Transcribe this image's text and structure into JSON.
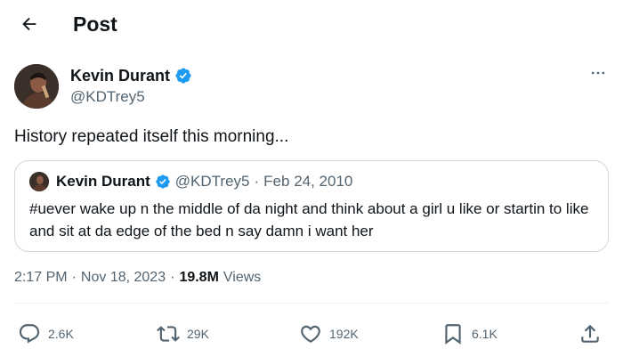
{
  "header": {
    "title": "Post",
    "back_icon": "arrow-left-icon"
  },
  "author": {
    "name": "Kevin Durant",
    "handle": "@KDTrey5",
    "verified_icon": "verified-badge-icon",
    "more_icon": "more-horizontal-icon"
  },
  "tweet": {
    "text": "History repeated itself this morning..."
  },
  "quote": {
    "name": "Kevin Durant",
    "handle": "@KDTrey5",
    "separator": "·",
    "date": "Feb 24, 2010",
    "text": "#uever wake up n the middle of da night and think about a girl u like or startin to like and sit at da edge of the bed n say damn i want her"
  },
  "meta": {
    "time": "2:17 PM",
    "separator1": "·",
    "date": "Nov 18, 2023",
    "separator2": "·",
    "views_count": "19.8M",
    "views_label": "Views"
  },
  "actions": {
    "reply": {
      "icon": "reply-icon",
      "count": "2.6K"
    },
    "repost": {
      "icon": "repost-icon",
      "count": "29K"
    },
    "like": {
      "icon": "heart-icon",
      "count": "192K"
    },
    "bookmark": {
      "icon": "bookmark-icon",
      "count": "6.1K"
    },
    "share": {
      "icon": "share-icon"
    }
  },
  "colors": {
    "text": "#0f1419",
    "secondary": "#536471",
    "verified": "#1d9bf0",
    "border": "#cfd9de"
  }
}
